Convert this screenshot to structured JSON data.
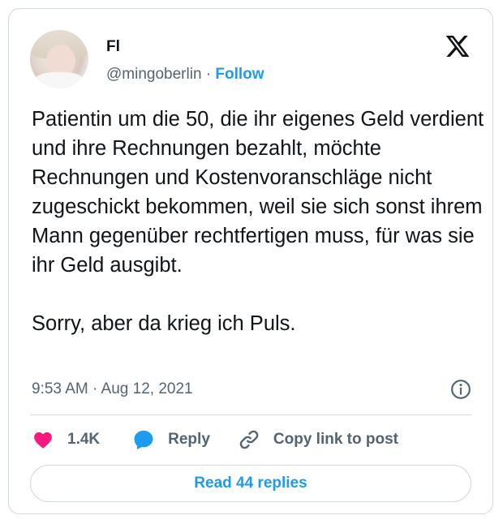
{
  "author": {
    "name": "Fl",
    "handle": "@mingoberlin",
    "separator": " · ",
    "follow_label": "Follow"
  },
  "brand_icon": "x-logo-icon",
  "tweet": {
    "text": "Patientin um die 50, die ihr eigenes Geld verdient und ihre Rechnungen bezahlt, möchte Rechnungen und Kostenvoranschläge nicht zugeschickt bekommen, weil sie sich sonst ihrem Mann gegenüber rechtfertigen muss, für was sie ihr Geld ausgibt.\n\nSorry, aber da krieg ich Puls.",
    "timestamp": "9:53 AM · Aug 12, 2021",
    "info_icon": "info-icon"
  },
  "actions": {
    "likes_count": "1.4K",
    "like_icon": "heart-icon",
    "reply_label": "Reply",
    "reply_icon": "speech-bubble-icon",
    "copy_label": "Copy link to post",
    "copy_icon": "link-icon"
  },
  "read_replies_label": "Read 44 replies",
  "colors": {
    "accent": "#1d9bf0",
    "heart": "#f91880",
    "text": "#0f1419",
    "muted": "#536471",
    "border": "#cfd9de"
  }
}
